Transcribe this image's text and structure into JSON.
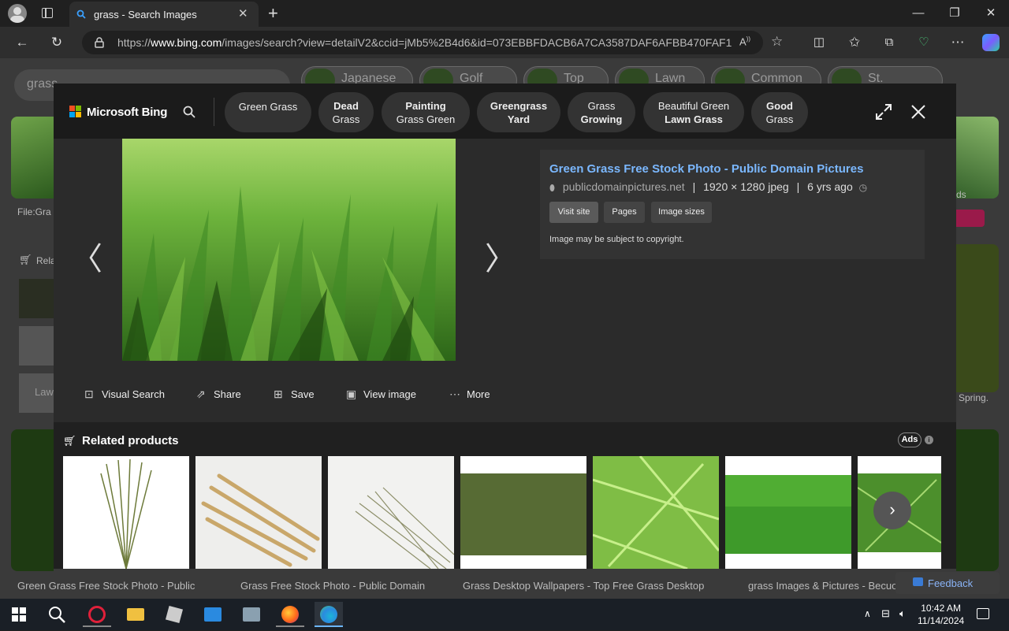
{
  "browser": {
    "tab_title": "grass - Search Images",
    "url_prefix": "https://",
    "url_domain": "www.bing.com",
    "url_rest": "/images/search?view=detailV2&ccid=jMb5%2B4d6&id=073EBBFDACB6A7CA3587DAF6AFBB470FAF1..."
  },
  "background_page": {
    "search_query": "grass",
    "chips": [
      "Japanese",
      "Golf",
      "Top",
      "Lawn",
      "Common",
      "St."
    ],
    "left_caption": "File:Gra",
    "left_related": "Rela",
    "left_lawn": "Law",
    "right_ads": "ds",
    "right_spring": "Spring.",
    "captions": [
      "Green Grass Free Stock Photo - Public",
      "Grass Free Stock Photo - Public Domain",
      "Grass Desktop Wallpapers - Top Free Grass Desktop",
      "grass Images & Pictures - Becuo"
    ],
    "feedback": "Feedback"
  },
  "overlay": {
    "brand": "Microsoft Bing",
    "chips": [
      {
        "line1": "Green Grass",
        "line2": ""
      },
      {
        "line1": "Dead",
        "line2": "Grass"
      },
      {
        "line1": "Painting",
        "line2": "Grass Green"
      },
      {
        "line1": "Greengrass",
        "line2": "Yard"
      },
      {
        "line1": "Grass",
        "line2": "Growing"
      },
      {
        "line1": "Beautiful Green",
        "line2": "Lawn Grass"
      },
      {
        "line1": "Good",
        "line2": "Grass"
      }
    ],
    "info": {
      "title": "Green Grass Free Stock Photo - Public Domain Pictures",
      "source": "publicdomainpictures.net",
      "dimensions": "1920 × 1280 jpeg",
      "age": "6 yrs ago",
      "buttons": [
        "Visit site",
        "Pages",
        "Image sizes"
      ],
      "copyright": "Image may be subject to copyright."
    },
    "actions": [
      "Visual Search",
      "Share",
      "Save",
      "View image",
      "More"
    ],
    "related_title": "Related products",
    "ads_label": "Ads"
  },
  "taskbar": {
    "time": "10:42 AM",
    "date": "11/14/2024"
  },
  "colors": {
    "accent_link": "#7bb8ff",
    "overlay_bg": "#2b2b2b",
    "header_bg": "#1b1b1b",
    "taskbar_bg": "#1a1f26"
  }
}
